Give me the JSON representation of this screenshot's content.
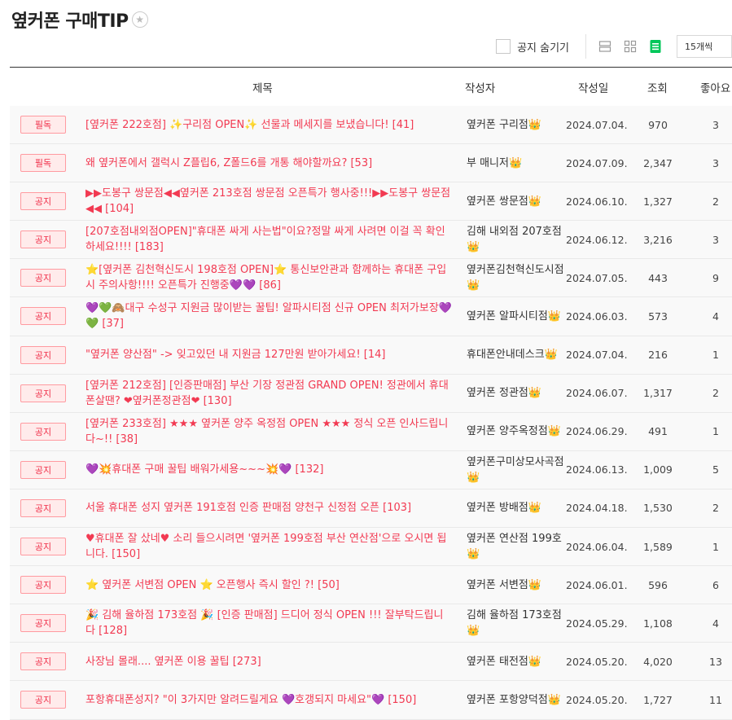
{
  "header": {
    "title": "옆커폰 구매TIP",
    "star_glyph": "★"
  },
  "toolbar": {
    "hide_notice_label": "공지 숨기기",
    "per_page": "15개씩"
  },
  "columns": {
    "subject": "제목",
    "author": "작성자",
    "date": "작성일",
    "views": "조회",
    "likes": "좋아요"
  },
  "rows": [
    {
      "badge": "필독",
      "subject": "[옆커폰 222호점] ✨구리점 OPEN✨ 선물과 메세지를 보냈습니다! [41]",
      "author": "옆커폰 구리점👑",
      "date": "2024.07.04.",
      "views": "970",
      "likes": "3"
    },
    {
      "badge": "필독",
      "subject": "왜 옆커폰에서 갤럭시 Z플립6, Z폴드6를 개통 해야할까요? [53]",
      "author": "부 매니저👑",
      "date": "2024.07.09.",
      "views": "2,347",
      "likes": "3"
    },
    {
      "badge": "공지",
      "subject": "▶▶도봉구 쌍문점◀◀옆커폰 213호점 쌍문점 오픈특가 행사중!!!▶▶도봉구 쌍문점◀◀ [104]",
      "author": "옆커폰 쌍문점👑",
      "date": "2024.06.10.",
      "views": "1,327",
      "likes": "2"
    },
    {
      "badge": "공지",
      "subject": "[207호점내외점OPEN]\"휴대폰 싸게 사는법\"이요?정말 싸게 사려면 이걸 꼭 확인하세요!!!! [183]",
      "author": "김해 내외점 207호점👑",
      "date": "2024.06.12.",
      "views": "3,216",
      "likes": "3"
    },
    {
      "badge": "공지",
      "subject": "⭐[옆커폰 김천혁신도시 198호점 OPEN]⭐ 통신보안관과 함께하는 휴대폰 구입 시 주의사항!!!! 오픈특가 진행중💜💜 [86]",
      "author": "옆커폰김천혁신도시점👑",
      "date": "2024.07.05.",
      "views": "443",
      "likes": "9"
    },
    {
      "badge": "공지",
      "subject": "💜💚🙈대구 수성구 지원금 많이받는 꿀팁! 알파시티점 신규 OPEN 최저가보장💜💚 [37]",
      "author": "옆커폰 알파시티점👑",
      "date": "2024.06.03.",
      "views": "573",
      "likes": "4"
    },
    {
      "badge": "공지",
      "subject": "\"옆커폰 양산점\" -> 잊고있던 내 지원금 127만원 받아가세요! [14]",
      "author": "휴대폰안내데스크👑",
      "date": "2024.07.04.",
      "views": "216",
      "likes": "1"
    },
    {
      "badge": "공지",
      "subject": "[옆커폰 212호점] [인증판매점] 부산 기장 정관점 GRAND OPEN! 정관에서 휴대폰살땐? ❤옆커폰정관점❤ [130]",
      "author": "옆커폰 정관점👑",
      "date": "2024.06.07.",
      "views": "1,317",
      "likes": "2"
    },
    {
      "badge": "공지",
      "subject": "[옆커폰 233호점] ★★★ 옆커폰 양주 옥정점 OPEN ★★★ 정식 오픈 인사드립니다~!! [38]",
      "author": "옆커폰 양주옥정점👑",
      "date": "2024.06.29.",
      "views": "491",
      "likes": "1"
    },
    {
      "badge": "공지",
      "subject": "💜💥휴대폰 구매 꿀팁 배워가세용~~~💥💜 [132]",
      "author": "옆커폰구미상모사곡점👑",
      "date": "2024.06.13.",
      "views": "1,009",
      "likes": "5"
    },
    {
      "badge": "공지",
      "subject": "서울 휴대폰 성지 옆커폰 191호점 인증 판매점 양천구 신정점 오픈 [103]",
      "author": "옆커폰 방배점👑",
      "date": "2024.04.18.",
      "views": "1,530",
      "likes": "2"
    },
    {
      "badge": "공지",
      "subject": "♥휴대폰 잘 샀네♥ 소리 들으시려면 '옆커폰 199호점 부산 연산점'으로 오시면 됩니다. [150]",
      "author": "옆커폰 연산점 199호👑",
      "date": "2024.06.04.",
      "views": "1,589",
      "likes": "1"
    },
    {
      "badge": "공지",
      "subject": "⭐ 옆커폰 서변점 OPEN ⭐ 오픈행사 즉시 할인 ?! [50]",
      "author": "옆커폰 서변점👑",
      "date": "2024.06.01.",
      "views": "596",
      "likes": "6"
    },
    {
      "badge": "공지",
      "subject": "🎉 김해 율하점 173호점 🎉 [인증 판매점] 드디어 정식 OPEN !!! 잘부탁드립니다 [128]",
      "author": "김해 율하점 173호점👑",
      "date": "2024.05.29.",
      "views": "1,108",
      "likes": "4"
    },
    {
      "badge": "공지",
      "subject": "사장님 몰래.... 옆커폰 이용 꿀팁 [273]",
      "author": "옆커폰 태전점👑",
      "date": "2024.05.20.",
      "views": "4,020",
      "likes": "13"
    },
    {
      "badge": "공지",
      "subject": "포항휴대폰성지? \"이 3가지만 알려드릴게요 💜호갱되지 마세요\"💜 [150]",
      "author": "옆커폰 포항양덕점👑",
      "date": "2024.05.20.",
      "views": "1,727",
      "likes": "11"
    }
  ]
}
